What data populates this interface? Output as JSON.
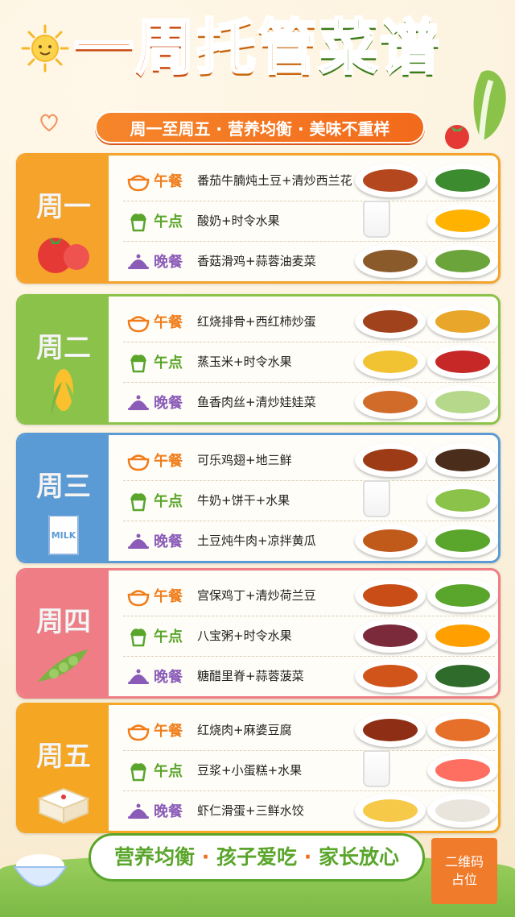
{
  "title": {
    "part1": "一周",
    "part2": "托管",
    "part3": "菜谱"
  },
  "subtitle": "周一至周五 · 营养均衡 · 美味不重样",
  "meal_types": {
    "lunch": "午餐",
    "snack": "午点",
    "dinner": "晚餐"
  },
  "days": [
    {
      "name": "周一",
      "color": "#f6a32b",
      "illustration": "tomato-icon",
      "lunch": "番茄牛腩炖土豆+清炒西兰花",
      "snack": "酸奶+时令水果",
      "dinner": "香菇滑鸡+蒜蓉油麦菜",
      "yogurt_label": "酸奶"
    },
    {
      "name": "周二",
      "color": "#8bc34a",
      "illustration": "corn-icon",
      "lunch": "红烧排骨+西红柿炒蛋",
      "snack": "蒸玉米+时令水果",
      "dinner": "鱼香肉丝+清炒娃娃菜"
    },
    {
      "name": "周三",
      "color": "#5b9bd5",
      "illustration": "milk-carton-icon",
      "lunch": "可乐鸡翅+地三鲜",
      "snack": "牛奶+饼干+水果",
      "dinner": "土豆炖牛肉+凉拌黄瓜",
      "milk_label": "MILK"
    },
    {
      "name": "周四",
      "color": "#ef7d86",
      "illustration": "peas-icon",
      "lunch": "宫保鸡丁+清炒荷兰豆",
      "snack": "八宝粥+时令水果",
      "dinner": "糖醋里脊+蒜蓉菠菜"
    },
    {
      "name": "周五",
      "color": "#f5a623",
      "illustration": "tofu-icon",
      "lunch": "红烧肉+麻婆豆腐",
      "snack": "豆浆+小蛋糕+水果",
      "dinner": "虾仁滑蛋+三鲜水饺"
    }
  ],
  "footer": {
    "part1": "营养均衡",
    "sep": "·",
    "part2": "孩子爱吃",
    "part3": "家长放心"
  },
  "qr": {
    "line1": "二维码",
    "line2": "占位"
  }
}
